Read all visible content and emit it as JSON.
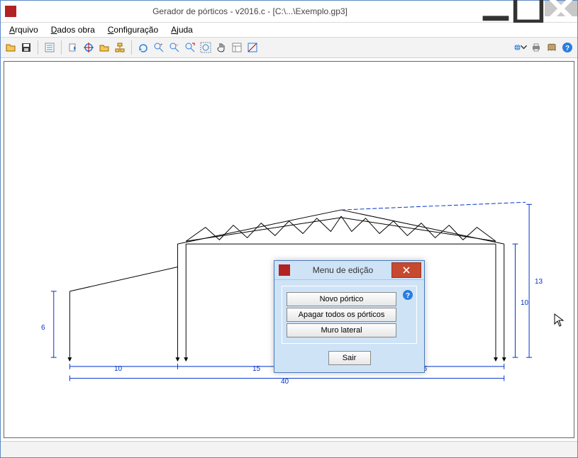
{
  "title": "Gerador de pórticos - v2016.c - [C:\\...\\Exemplo.gp3]",
  "menu": {
    "arquivo": "Arquivo",
    "dados": "Dados obra",
    "config": "Configuração",
    "ajuda": "Ajuda"
  },
  "dims": {
    "d10a": "10",
    "d15a": "15",
    "d15b": "15",
    "d40": "40",
    "d6": "6",
    "d10v": "10",
    "d13": "13"
  },
  "dialog": {
    "title": "Menu de edição",
    "novo": "Novo pórtico",
    "apagar": "Apagar todos os pórticos",
    "muro": "Muro lateral",
    "sair": "Sair"
  },
  "icons": {
    "open": "open-icon",
    "save": "save-icon",
    "list": "list-icon",
    "export": "export-icon",
    "plan": "plan-icon",
    "folder": "folder-icon",
    "org": "org-icon",
    "rebuild": "rebuild-icon",
    "z1": "zoom1-icon",
    "z2": "zoom2-icon",
    "z3": "zoom3-icon",
    "zfit": "zoom-fit-icon",
    "pan": "pan-icon",
    "layers": "layers-icon",
    "measure": "measure-icon",
    "globe": "globe-icon",
    "print": "print-icon",
    "book": "book-icon",
    "help": "help-icon"
  }
}
